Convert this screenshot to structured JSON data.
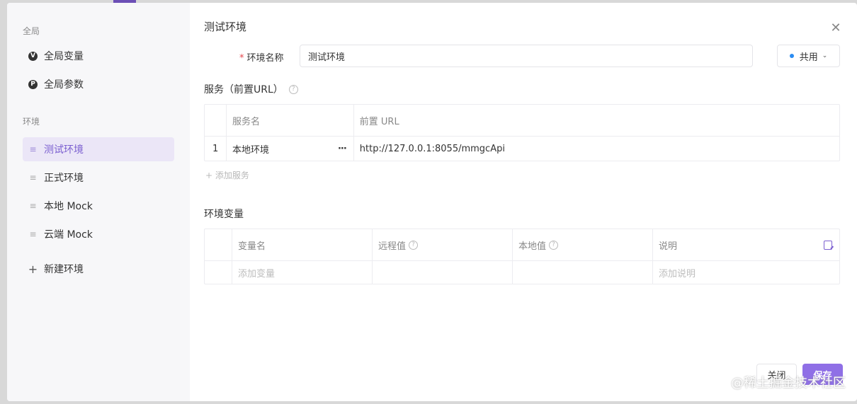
{
  "modal": {
    "title": "测试环境",
    "close_icon": "close-icon"
  },
  "sidebar": {
    "global_section": "全局",
    "global_items": [
      {
        "label": "全局变量",
        "icon": "variable-circle-icon",
        "glyph": "V"
      },
      {
        "label": "全局参数",
        "icon": "parameter-circle-icon",
        "glyph": "P"
      }
    ],
    "env_section": "环境",
    "env_items": [
      {
        "label": "测试环境",
        "active": true
      },
      {
        "label": "正式环境",
        "active": false
      },
      {
        "label": "本地 Mock",
        "active": false
      },
      {
        "label": "云端 Mock",
        "active": false
      }
    ],
    "new_env_label": "新建环境"
  },
  "form": {
    "name_label": "环境名称",
    "required_mark": "*",
    "name_value": "测试环境",
    "share_label": "共用",
    "share_dot_color": "#2a8cf2"
  },
  "services": {
    "title": "服务（前置URL）",
    "headers": [
      "服务名",
      "前置 URL"
    ],
    "rows": [
      {
        "index": "1",
        "name": "本地环境",
        "url": "http://127.0.0.1:8055/mmgcApi"
      }
    ],
    "add_label": "+ 添加服务"
  },
  "variables": {
    "title": "环境变量",
    "headers": [
      "变量名",
      "远程值",
      "本地值",
      "说明"
    ],
    "add_variable_placeholder": "添加变量",
    "add_description_placeholder": "添加说明"
  },
  "footer": {
    "close_label": "关闭",
    "save_label": "保存"
  },
  "watermark": "@稀土掘金技术社区",
  "colors": {
    "accent": "#8f6fe6",
    "active_bg": "#ebe6f7",
    "active_text": "#7b5fd0"
  }
}
